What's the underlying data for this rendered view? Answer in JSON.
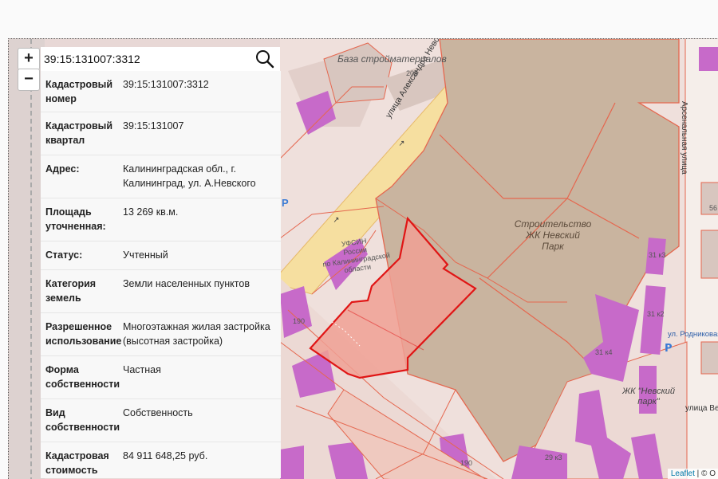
{
  "search": {
    "value": "39:15:131007:3312"
  },
  "zoom": {
    "in_label": "+",
    "out_label": "−"
  },
  "info": [
    {
      "key": "Кадастровый номер",
      "value": "39:15:131007:3312"
    },
    {
      "key": "Кадастровый квартал",
      "value": "39:15:131007"
    },
    {
      "key": "Адрес:",
      "value": "Калининградская обл., г. Калининград, ул. А.Невского"
    },
    {
      "key": "Площадь уточненная:",
      "value": "13 269 кв.м."
    },
    {
      "key": "Статус:",
      "value": "Учтенный"
    },
    {
      "key": "Категория земель",
      "value": "Земли населенных пунктов"
    },
    {
      "key": "Разрешенное использование",
      "value": "Многоэтажная жилая застройка (высотная застройка)"
    },
    {
      "key": "Форма собственности",
      "value": "Частная"
    },
    {
      "key": "Вид собственности",
      "value": "Собственность"
    },
    {
      "key": "Кадастровая стоимость",
      "value": "84 911 648,25 руб."
    }
  ],
  "map": {
    "labels": {
      "base": "База стройматериалов",
      "street_nevsky": "улица Александра Невского",
      "construction": [
        "Строительство",
        "ЖК Невский",
        "Парк"
      ],
      "arsenalnaya": "Арсенальная улица",
      "ufsin": [
        "УФСИН",
        "России",
        "по Калининградской",
        "области"
      ],
      "rodnikovaya": "ул. Родниковая",
      "zhk": [
        "ЖК \"Невский",
        "парк\""
      ],
      "street_ve": "улица Ве",
      "b205": "205",
      "b190a": "190",
      "b190b": "190",
      "b31_3": "31 к3",
      "b31_2": "31 к2",
      "b31_4": "31 к4",
      "b29_3": "29 к3",
      "b56": "56",
      "parking": "P"
    },
    "attribution": {
      "leaflet": "Leaflet",
      "rest": " | © O"
    }
  },
  "colors": {
    "map_bg": "#efe0dc",
    "road": "#f6dfa0",
    "building": "#d8c6bf",
    "construction": "#c9b49f",
    "purple": "#c76ac9",
    "cad_line": "#e5674f",
    "selected_fill": "#f0a094",
    "selected_stroke": "#e01515"
  }
}
